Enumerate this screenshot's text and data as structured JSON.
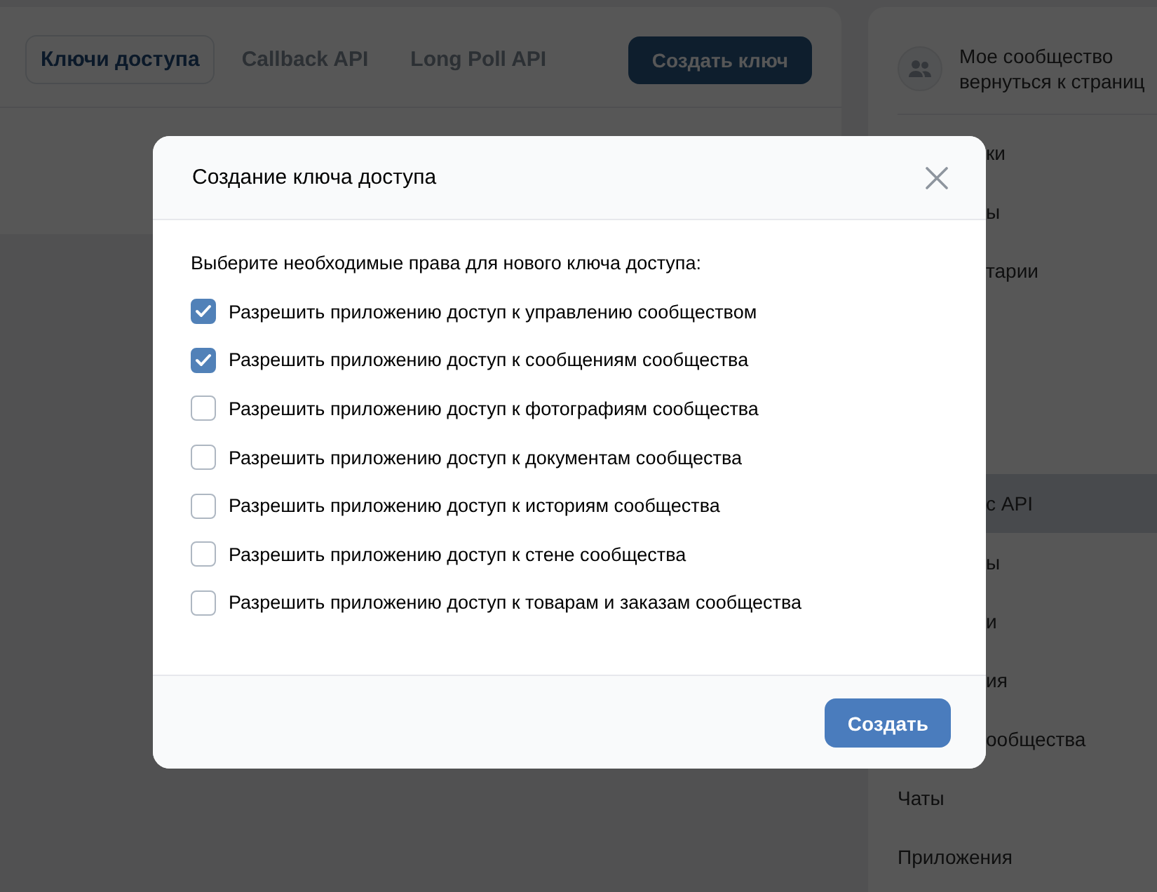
{
  "tabs": [
    {
      "label": "Ключи доступа",
      "selected": true
    },
    {
      "label": "Callback API",
      "selected": false
    },
    {
      "label": "Long Poll API",
      "selected": false
    }
  ],
  "create_key_button": "Создать ключ",
  "sidebar": {
    "community_name": "Мое сообщество",
    "back_link": "вернуться к страниц",
    "items": [
      {
        "label": "ки",
        "under_dialog": true,
        "after_gap": false,
        "selected": false
      },
      {
        "label": "ы",
        "under_dialog": true,
        "after_gap": false,
        "selected": false
      },
      {
        "label": "тарии",
        "under_dialog": true,
        "after_gap": false,
        "selected": false
      },
      {
        "label": "с API",
        "under_dialog": true,
        "after_gap": true,
        "selected": true
      },
      {
        "label": "ы",
        "under_dialog": true,
        "after_gap": false,
        "selected": false
      },
      {
        "label": "и",
        "under_dialog": true,
        "after_gap": false,
        "selected": false
      },
      {
        "label": "ия",
        "under_dialog": true,
        "after_gap": false,
        "selected": false
      },
      {
        "label": "ообщества",
        "under_dialog": true,
        "after_gap": false,
        "selected": false
      },
      {
        "label": "Чаты",
        "under_dialog": false,
        "after_gap": false,
        "selected": false
      },
      {
        "label": "Приложения",
        "under_dialog": false,
        "after_gap": false,
        "selected": false
      }
    ]
  },
  "dialog": {
    "title": "Создание ключа доступа",
    "prompt": "Выберите необходимые права для нового ключа доступа:",
    "permissions": [
      {
        "label": "Разрешить приложению доступ к управлению сообществом",
        "checked": true
      },
      {
        "label": "Разрешить приложению доступ к сообщениям сообщества",
        "checked": true
      },
      {
        "label": "Разрешить приложению доступ к фотографиям сообщества",
        "checked": false
      },
      {
        "label": "Разрешить приложению доступ к документам сообщества",
        "checked": false
      },
      {
        "label": "Разрешить приложению доступ к историям сообщества",
        "checked": false
      },
      {
        "label": "Разрешить приложению доступ к стене сообщества",
        "checked": false
      },
      {
        "label": "Разрешить приложению доступ к товарам и заказам сообщества",
        "checked": false
      }
    ],
    "submit_button": "Создать"
  }
}
